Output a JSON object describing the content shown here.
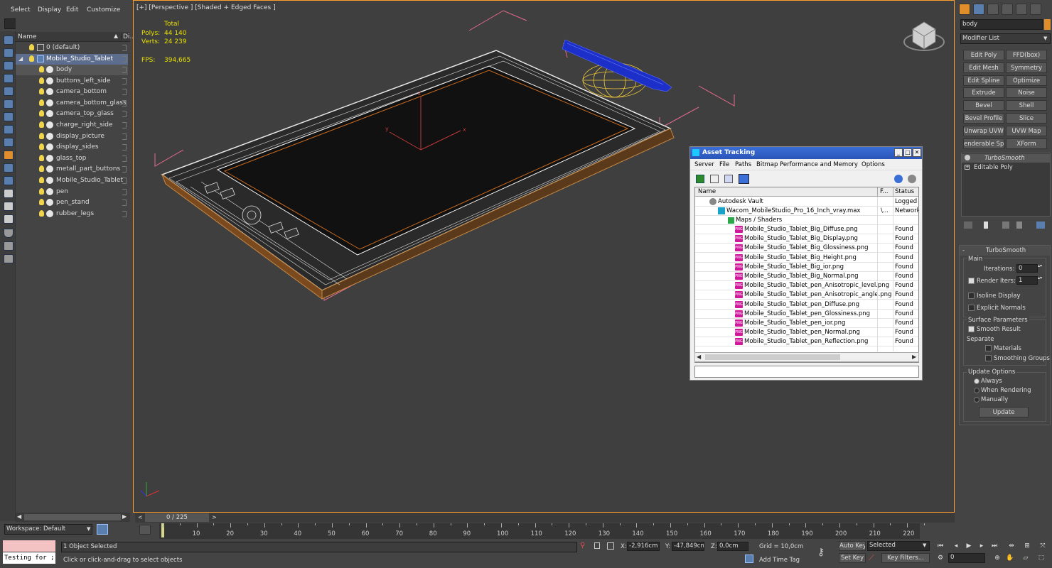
{
  "menu": {
    "select": "Select",
    "display": "Display",
    "edit": "Edit",
    "customize": "Customize"
  },
  "explorer": {
    "col_name": "Name",
    "col_d": "Di..",
    "root_layer": "0 (default)",
    "group": "Mobile_Studio_Tablet",
    "objects": [
      "body",
      "buttons_left_side",
      "camera_bottom",
      "camera_bottom_glass",
      "camera_top_glass",
      "charge_right_side",
      "display_picture",
      "display_sides",
      "glass_top",
      "metall_part_buttons",
      "Mobile_Studio_Tablet",
      "pen",
      "pen_stand",
      "rubber_legs"
    ],
    "workspace": "Workspace: Default"
  },
  "viewport": {
    "label": "[+] [Perspective ] [Shaded + Edged Faces ]",
    "stats_total": "Total",
    "polys_label": "Polys:",
    "polys": "44 140",
    "verts_label": "Verts:",
    "verts": "24 239",
    "fps_label": "FPS:",
    "fps": "394,665",
    "axis_x": "x",
    "axis_y": "y",
    "axis_z": "z"
  },
  "asset": {
    "title": "Asset Tracking",
    "menu": [
      "Server",
      "File",
      "Paths",
      "Bitmap Performance and Memory",
      "Options"
    ],
    "col_name": "Name",
    "col_f": "F...",
    "col_status": "Status",
    "vault": "Autodesk Vault",
    "vault_status": "Logged O",
    "file": "Wacom_MobileStudio_Pro_16_Inch_vray.max",
    "file_path": "\\...",
    "file_status": "Network",
    "maps": "Maps / Shaders",
    "png_label": "PNG",
    "textures": [
      {
        "name": "Mobile_Studio_Tablet_Big_Diffuse.png",
        "status": "Found"
      },
      {
        "name": "Mobile_Studio_Tablet_Big_Display.png",
        "status": "Found"
      },
      {
        "name": "Mobile_Studio_Tablet_Big_Glossiness.png",
        "status": "Found"
      },
      {
        "name": "Mobile_Studio_Tablet_Big_Height.png",
        "status": "Found"
      },
      {
        "name": "Mobile_Studio_Tablet_Big_ior.png",
        "status": "Found"
      },
      {
        "name": "Mobile_Studio_Tablet_Big_Normal.png",
        "status": "Found"
      },
      {
        "name": "Mobile_Studio_Tablet_pen_Anisotropic_level.png",
        "status": "Found"
      },
      {
        "name": "Mobile_Studio_Tablet_pen_Anisotropic_angle.png",
        "status": "Found"
      },
      {
        "name": "Mobile_Studio_Tablet_pen_Diffuse.png",
        "status": "Found"
      },
      {
        "name": "Mobile_Studio_Tablet_pen_Glossiness.png",
        "status": "Found"
      },
      {
        "name": "Mobile_Studio_Tablet_pen_ior.png",
        "status": "Found"
      },
      {
        "name": "Mobile_Studio_Tablet_pen_Normal.png",
        "status": "Found"
      },
      {
        "name": "Mobile_Studio_Tablet_pen_Reflection.png",
        "status": "Found"
      }
    ]
  },
  "cmd": {
    "object_name": "body",
    "modifier_list": "Modifier List",
    "buttons": [
      [
        "Edit Poly",
        "FFD(box)"
      ],
      [
        "Edit Mesh",
        "Symmetry"
      ],
      [
        "Edit Spline",
        "Optimize"
      ],
      [
        "Extrude",
        "Noise"
      ],
      [
        "Bevel",
        "Shell"
      ],
      [
        "Bevel Profile",
        "Slice"
      ],
      [
        "Unwrap UVW",
        "UVW Map"
      ],
      [
        "enderable Splin",
        "XForm"
      ]
    ],
    "stack": [
      "TurboSmooth",
      "Editable Poly"
    ],
    "rollout_title": "TurboSmooth",
    "main": "Main",
    "iterations_label": "Iterations:",
    "iterations": "0",
    "render_iters_label": "Render Iters:",
    "render_iters": "1",
    "isoline": "Isoline Display",
    "explicit": "Explicit Normals",
    "surface": "Surface Parameters",
    "smooth_result": "Smooth Result",
    "separate": "Separate",
    "materials": "Materials",
    "smoothing_groups": "Smoothing Groups",
    "update_options": "Update Options",
    "always": "Always",
    "when_rendering": "When Rendering",
    "manually": "Manually",
    "update": "Update"
  },
  "timeline": {
    "frame": "0 / 225",
    "ticks": [
      "10",
      "20",
      "30",
      "40",
      "50",
      "60",
      "70",
      "80",
      "90",
      "100",
      "110",
      "120",
      "130",
      "140",
      "150",
      "160",
      "170",
      "180",
      "190",
      "200",
      "210",
      "220"
    ]
  },
  "status": {
    "script": "Testing for ;",
    "selected": "1 Object Selected",
    "prompt": "Click or click-and-drag to select objects",
    "x_label": "X:",
    "x": "-2,916cm",
    "y_label": "Y:",
    "y": "-47,849cm",
    "z_label": "Z:",
    "z": "0,0cm",
    "grid": "Grid = 10,0cm",
    "add_time_tag": "Add Time Tag",
    "auto_key": "Auto Key",
    "set_key": "Set Key",
    "selected_set": "Selected",
    "key_filters": "Key Filters...",
    "frame_field": "0"
  }
}
